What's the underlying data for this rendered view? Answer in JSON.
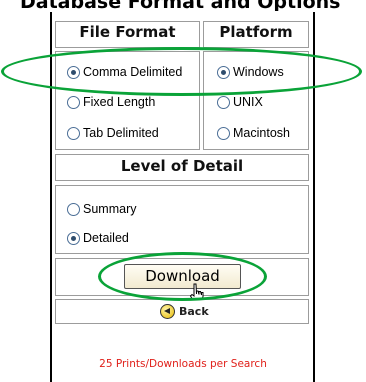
{
  "page_heading_partial": "Database Format and Options",
  "file_format": {
    "heading": "File Format",
    "options": [
      {
        "label": "Comma Delimited",
        "selected": true
      },
      {
        "label": "Fixed Length",
        "selected": false
      },
      {
        "label": "Tab Delimited",
        "selected": false
      }
    ]
  },
  "platform": {
    "heading": "Platform",
    "options": [
      {
        "label": "Windows",
        "selected": true
      },
      {
        "label": "UNIX",
        "selected": false
      },
      {
        "label": "Macintosh",
        "selected": false
      }
    ]
  },
  "level_of_detail": {
    "heading": "Level of Detail",
    "options": [
      {
        "label": "Summary",
        "selected": false
      },
      {
        "label": "Detailed",
        "selected": true
      }
    ]
  },
  "download_button": "Download",
  "back_link": "Back",
  "footer_note": "25 Prints/Downloads per Search",
  "colors": {
    "highlight": "#0aa338",
    "footer_text": "#e0201a",
    "panel_border": "#9c9c9c",
    "button_bg": "#f6f0da"
  },
  "icons": {
    "back": "back-arrow-icon",
    "cursor": "pointer-cursor-icon",
    "radio_selected": "radio-selected-icon",
    "radio_unselected": "radio-unselected-icon"
  }
}
